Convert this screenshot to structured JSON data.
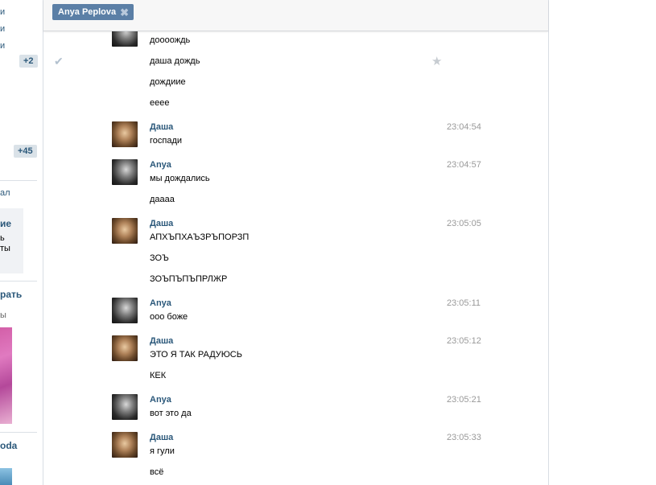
{
  "left": {
    "links": [
      "и",
      "и",
      "и"
    ],
    "badge1": "+2",
    "badge2": "+45",
    "line1": "ал",
    "box_title": "ие",
    "box_line1": "ь",
    "box_line2": "ты",
    "bold2": "рать",
    "line2": "ы",
    "bold3": "oda"
  },
  "header": {
    "recipient": "Anya Peplova",
    "close_glyph": "✖"
  },
  "icons": {
    "check": "check-icon",
    "star": "star-icon"
  },
  "messages": [
    {
      "author": "",
      "time": "",
      "avatar": "anya",
      "lines": [
        "доооождь",
        "даша дождь",
        "дождиие",
        "ееее"
      ]
    },
    {
      "author": "Даша",
      "time": "23:04:54",
      "avatar": "dasha",
      "lines": [
        "госпади"
      ]
    },
    {
      "author": "Anya",
      "time": "23:04:57",
      "avatar": "anya",
      "lines": [
        "мы дождались",
        "даааа"
      ]
    },
    {
      "author": "Даша",
      "time": "23:05:05",
      "avatar": "dasha",
      "lines": [
        "АПХЪПХАЪЗРЪПОРЗП",
        "ЗОЪ",
        "ЗОЪПЪПЪПРЛЖР"
      ]
    },
    {
      "author": "Anya",
      "time": "23:05:11",
      "avatar": "anya",
      "lines": [
        "ооо боже"
      ]
    },
    {
      "author": "Даша",
      "time": "23:05:12",
      "avatar": "dasha",
      "lines": [
        "ЭТО Я ТАК РАДУЮСЬ",
        "КЕК"
      ]
    },
    {
      "author": "Anya",
      "time": "23:05:21",
      "avatar": "anya",
      "lines": [
        "вот это да"
      ]
    },
    {
      "author": "Даша",
      "time": "23:05:33",
      "avatar": "dasha",
      "lines": [
        "я гули",
        "всё"
      ]
    }
  ]
}
